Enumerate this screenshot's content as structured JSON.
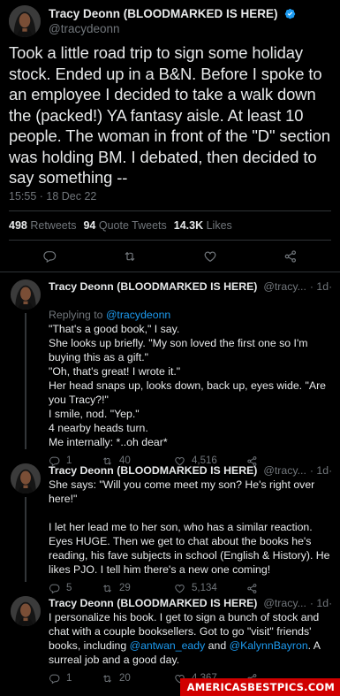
{
  "main_tweet": {
    "author_name": "Tracy Deonn (BLOODMARKED IS HERE)",
    "handle": "@tracydeonn",
    "text": "Took a little road trip to sign some holiday stock. Ended up in a B&N. Before I spoke to an employee I decided to take a walk down the (packed!) YA fantasy aisle. At least 10 people. The woman in front of the \"D\" section was holding BM. I debated, then decided to say something --",
    "timestamp": "15:55 · 18 Dec 22",
    "retweets_count": "498",
    "retweets_label": "Retweets",
    "quote_count": "94",
    "quote_label": "Quote Tweets",
    "likes_count": "14.3K",
    "likes_label": "Likes"
  },
  "replies": [
    {
      "author_name": "Tracy Deonn (BLOODMARKED IS HERE)",
      "handle": "@tracy...",
      "age": "· 1d",
      "replying_prefix": "Replying to ",
      "replying_to": "@tracydeonn",
      "text": "\"That's a good book,\" I say.\nShe looks up briefly. \"My son loved the first one so I'm buying this as a gift.\"\n\"Oh, that's great! I wrote it.\"\nHer head snaps up, looks down, back up, eyes wide. \"Are you Tracy?!\"\nI smile, nod. \"Yep.\"\n4 nearby heads turn.\nMe internally: *..oh dear*",
      "reply_count": "1",
      "retweet_count": "40",
      "like_count": "4,516"
    },
    {
      "author_name": "Tracy Deonn (BLOODMARKED IS HERE)",
      "handle": "@tracy...",
      "age": "· 1d",
      "text": "She says: \"Will you come meet my son? He's right over here!\"\n\nI let her lead me to her son, who has a similar reaction. Eyes HUGE. Then we get to chat about the books he's reading, his fave subjects in school (English & History). He likes PJO. I tell him there's a new one coming!",
      "reply_count": "5",
      "retweet_count": "29",
      "like_count": "5,134"
    },
    {
      "author_name": "Tracy Deonn (BLOODMARKED IS HERE)",
      "handle": "@tracy...",
      "age": "· 1d",
      "text_before": "I personalize his book. I get to sign a bunch of stock and chat with a couple booksellers. Got to go \"visit\" friends' books, including ",
      "mention_1": "@antwan_eady",
      "text_mid": " and ",
      "mention_2": "@KalynnBayron",
      "text_after": ". A surreal job and a good day.",
      "reply_count": "1",
      "retweet_count": "20",
      "like_count": "4,367"
    }
  ],
  "more_label": "···",
  "watermark": "AMERICASBESTPICS.COM",
  "colors": {
    "background": "#000000",
    "text": "#e7e9ea",
    "muted": "#71767b",
    "accent": "#1d9bf0",
    "watermark_bg": "#d10000"
  },
  "icons": [
    "verified-badge-icon",
    "reply-icon",
    "retweet-icon",
    "like-icon",
    "share-icon"
  ]
}
